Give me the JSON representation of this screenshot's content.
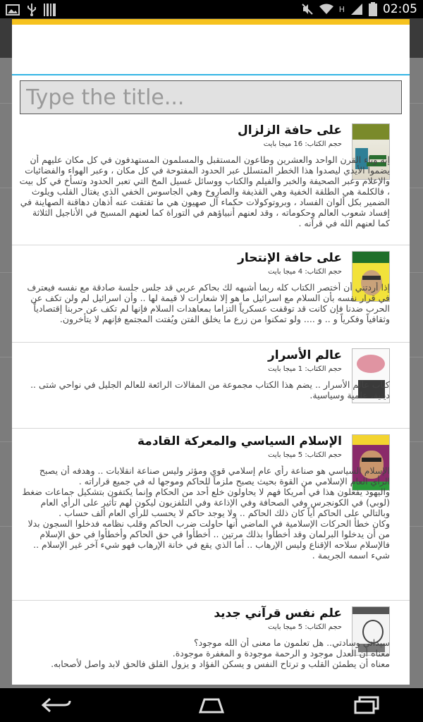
{
  "status_bar": {
    "time": "02:05",
    "network_label": "H"
  },
  "dialog": {
    "title_placeholder": "Type the title...",
    "books": [
      {
        "title": "على حافة الزلزال",
        "size": "حجم الكتاب: 16 ميجا بايت",
        "description": "إنه وباء القرن الواحد والعشرين وطاعون المستقبل والمسلمون المستهدفون في كل مكان عليهم أن يضموا الأيدي ليصدوا هذا الخطر المتسلل عبر الحدود المفتوحة في كل مكان ، وعبر الهواء والفضائيات والإعلام وعبر الصحيفة والخبر والفيلم والكتاب ووسائل غسيل المخ التي تعبر الحدود وتسأخ في كل بيت ، فالكلمة هي الطلقة الخفية وهي القذيفة والصاروخ وهي الجاسوس الخفي الذي يغتال القلب ويلوث الضمير بكل ألوان الفساد ، وبروتوكولات حكماء آل صهيون هي ما تفتقت عنه أذهان دهاقنة الصهاينة في إفساد شعوب العالم وحكوماته ، وقد لعنهم أنبياؤهم في التوراة كما لعنهم المسيح في الأناجيل الثلاثة كما لعنهم الله في قرآنه ."
      },
      {
        "title": "على حافة الإنتحار",
        "size": "حجم الكتاب: 4 ميجا بايت",
        "description": "إذا أردتني أن أختصر الكتاب كله ربما أشبهه لك بحاكم عربي قد جلس جلسة صادقة مع نفسه فيعترف في قرار نفسه بأن السلام مع اسرائيل ما هو إلا شعارات لا قيمة لها .. وأن اسرائيل لم ولن تكف عن الحرب ضدنا فإن كانت قد توقفت عسكرياً التزاما بمعاهدات السلام فإنها لم تكف عن حربنا إقتصادياً وثقافياً وفكرياً و .. و .... ولو تمكنوا من زرع ما يخلق الفتن ويُفتت المجتمع فإنهم لا يتأخرون."
      },
      {
        "title": "عالم الأسرار",
        "size": "حجم الكتاب: 1 ميجا بايت",
        "description": "كتاب عالم الأسرار .. يضم هذا الكتاب مجموعة من المقالات الرائعة للعالم الجليل في نواحي شتى .. دينية، علمية وسياسية."
      },
      {
        "title": "الإسلام السياسي والمعركة القادمة",
        "size": "حجم الكتاب: 5 ميجا بايت",
        "description": "الإسلام السياسي هو صناعة رأي عام إسلامي قوي ومؤثر وليس صناعة انقلابات .. وهدفه أن يصبح الرأي العام الإسلامي من القوة بحيث يصبح ملزماً للحاكم وموجها له في جميع قراراته .\nواليهود يفعلون هذا في أمريكا فهم لا يحاولون خلع أحد من الحكام وإنما يكتفون بتشكيل جماعات ضغط (لوبي) في الكونجرس وفي الصحافة وفي الإذاعة وفي التلفزيون ليكون لهم تأثير على الرأي العام وبالتالي على الحاكم أياً كان ذلك الحاكم .. ولا يوجد حاكم لا يحسب للرأي العام ألف حساب .\nوكان خطأ الحركات الإسلامية في الماضي أنها حاولت ضرب الحاكم وقلب نظامه فدخلوا السجون بدلا من أن يدخلوا البرلمان وقد أخطأوا بذلك مرتين .. أخطأوا في حق الحاكم وأخطأوا في حق الإسلام فالإسلام سلاحه الإقناع وليس الإرهاب .. أما الذي يقع في خانة الإرهاب فهو شيء آخر غير الإسلام .. شيء اسمه الجريمة ."
      },
      {
        "title": "علم نفس قرآني جديد",
        "size": "حجم الكتاب: 5 ميجا بايت",
        "description": "سيداتي وسادتي.. هل تعلمون ما معنى أن الله موجود؟\nمعناه أن العدل موجود و الرحمة موجودة و المغفرة موجودة.\nمعناه أن يطمئن القلب و ترتاح النفس و يسكن الفؤاد و يزول القلق فالحق لابد واصل لأصحابه."
      }
    ]
  },
  "nav_bar": {
    "back": "back-icon",
    "home": "home-icon",
    "recents": "recents-icon"
  }
}
